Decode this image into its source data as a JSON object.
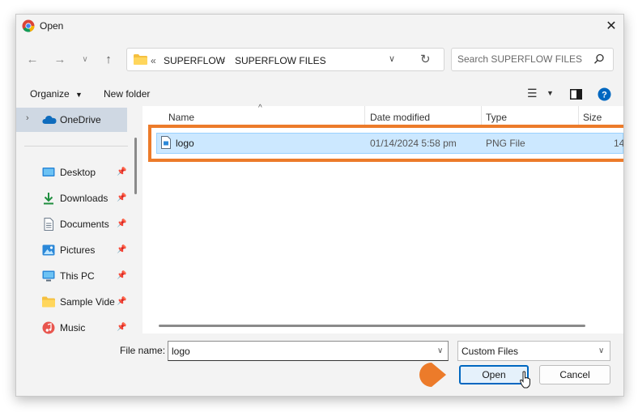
{
  "window": {
    "title": "Open"
  },
  "address": {
    "overflow": "«",
    "crumbs": [
      "SUPERFLOW",
      "SUPERFLOW FILES"
    ],
    "separator": "›"
  },
  "search": {
    "placeholder": "Search SUPERFLOW FILES"
  },
  "toolbar": {
    "organize_label": "Organize",
    "new_folder_label": "New folder"
  },
  "sidebar": {
    "onedrive_label": "OneDrive",
    "items": [
      {
        "label": "Desktop",
        "icon": "desktop-icon"
      },
      {
        "label": "Downloads",
        "icon": "downloads-icon"
      },
      {
        "label": "Documents",
        "icon": "documents-icon"
      },
      {
        "label": "Pictures",
        "icon": "pictures-icon"
      },
      {
        "label": "This PC",
        "icon": "this-pc-icon"
      },
      {
        "label": "Sample Videos",
        "icon": "folder-icon"
      },
      {
        "label": "Music",
        "icon": "music-icon"
      }
    ]
  },
  "columns": {
    "name": "Name",
    "date": "Date modified",
    "type": "Type",
    "size": "Size"
  },
  "files": [
    {
      "name": "logo",
      "date": "01/14/2024 5:58 pm",
      "type": "PNG File",
      "size": "14"
    }
  ],
  "footer": {
    "file_name_label": "File name:",
    "file_name_value": "logo",
    "filter_value": "Custom Files",
    "open_label": "Open",
    "cancel_label": "Cancel"
  },
  "colors": {
    "accent": "#0067c0",
    "highlight": "#ec7b2a",
    "selection": "#cce8ff"
  }
}
